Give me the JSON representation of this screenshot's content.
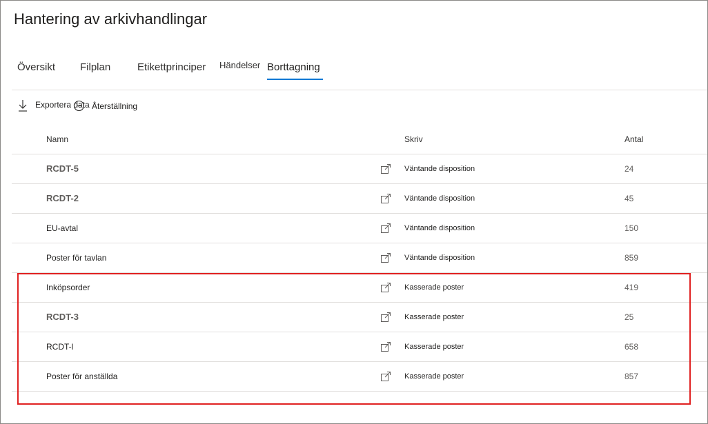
{
  "page": {
    "title": "Hantering av arkivhandlingar"
  },
  "tabs": [
    {
      "label": "Översikt"
    },
    {
      "label": "Filplan"
    },
    {
      "label": "Etikettprinciper"
    },
    {
      "label": "Händelser"
    },
    {
      "label": "Borttagning",
      "active": true
    }
  ],
  "toolbar": {
    "export_label": "Exportera data",
    "reset_label": "Återställning"
  },
  "table": {
    "columns": {
      "name": "Namn",
      "type": "Skriv",
      "count": "Antal"
    },
    "rows": [
      {
        "name": "RCDT-5",
        "type": "Väntande disposition",
        "count": "24"
      },
      {
        "name": "RCDT-2",
        "type": "Väntande disposition",
        "count": "45"
      },
      {
        "name": "EU-avtal",
        "type": "Väntande disposition",
        "count": "150"
      },
      {
        "name": "Poster för tavlan",
        "type": "Väntande disposition",
        "count": "859"
      },
      {
        "name": "Inköpsorder",
        "type": "Kasserade poster",
        "count": "419"
      },
      {
        "name": "RCDT-3",
        "type": "Kasserade poster",
        "count": "25"
      },
      {
        "name": "RCDT-l",
        "type": "Kasserade poster",
        "count": "658"
      },
      {
        "name": "Poster för anställda",
        "type": "Kasserade poster",
        "count": "857"
      }
    ]
  },
  "colors": {
    "accent": "#0078d4",
    "highlight": "#e02020"
  },
  "icons": {
    "export": "download-arrow-icon",
    "reset": "reset-circle-icon",
    "open": "open-in-new-icon"
  }
}
